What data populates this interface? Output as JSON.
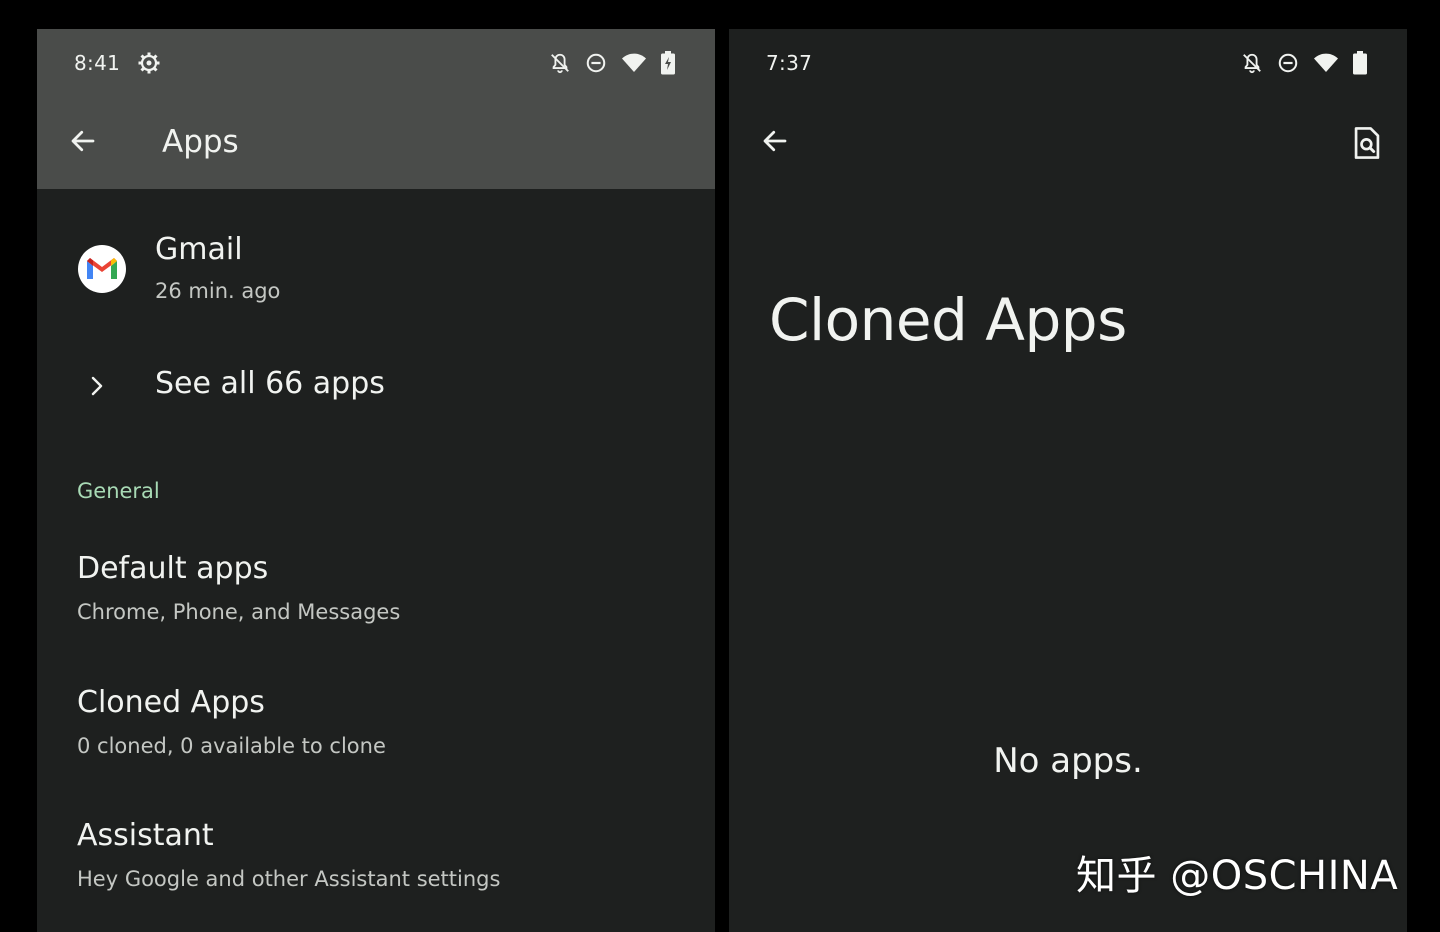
{
  "left_screen": {
    "status_bar": {
      "time": "8:41",
      "icons": [
        "settings-gear-icon",
        "bell-off-icon",
        "do-not-disturb-icon",
        "wifi-icon",
        "battery-charging-icon"
      ]
    },
    "app_bar": {
      "title": "Apps",
      "back_icon": "arrow-back-icon"
    },
    "recent_app": {
      "name": "Gmail",
      "time": "26 min. ago",
      "icon": "gmail-logo"
    },
    "see_all": {
      "label": "See all 66 apps",
      "icon": "chevron-right-icon"
    },
    "section_header": "General",
    "items": [
      {
        "title": "Default apps",
        "subtitle": "Chrome, Phone, and Messages"
      },
      {
        "title": "Cloned Apps",
        "subtitle": "0 cloned, 0 available to clone"
      },
      {
        "title": "Assistant",
        "subtitle": "Hey Google and other Assistant settings"
      }
    ]
  },
  "right_screen": {
    "status_bar": {
      "time": "7:37",
      "icons": [
        "bell-off-icon",
        "do-not-disturb-icon",
        "wifi-icon",
        "battery-icon"
      ]
    },
    "back_icon": "arrow-back-icon",
    "action_icon": "document-search-icon",
    "title": "Cloned Apps",
    "empty_message": "No apps."
  },
  "watermark": "知乎 @OSCHINA",
  "colors": {
    "background": "#1e201f",
    "header": "#4a4c4a",
    "accent": "#a8dab5",
    "text_primary": "#f1f3f0",
    "text_secondary": "#c4c7c3"
  }
}
